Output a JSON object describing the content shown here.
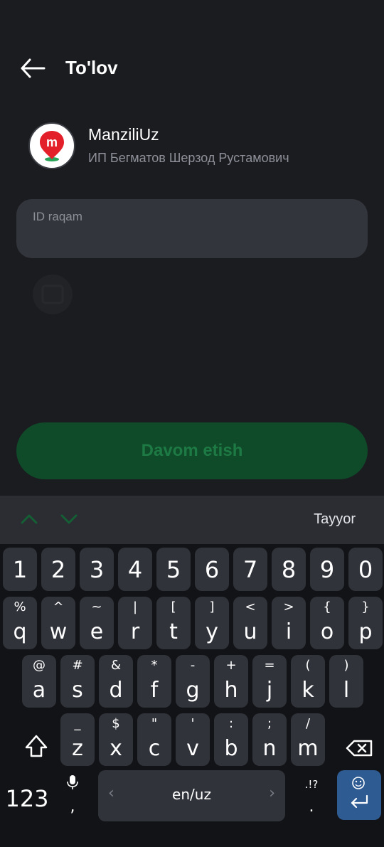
{
  "header": {
    "title": "To'lov"
  },
  "merchant": {
    "name": "ManziliUz",
    "owner": "ИП Бегматов Шерзод Рустамович",
    "logo_letter": "m"
  },
  "form": {
    "id_placeholder": "ID raqam",
    "id_value": ""
  },
  "continue_label": "Davom etish",
  "toolbar": {
    "done_label": "Tayyor"
  },
  "keyboard": {
    "number_row": [
      "1",
      "2",
      "3",
      "4",
      "5",
      "6",
      "7",
      "8",
      "9",
      "0"
    ],
    "row1": [
      {
        "main": "q",
        "sub": "%"
      },
      {
        "main": "w",
        "sub": "^"
      },
      {
        "main": "e",
        "sub": "~"
      },
      {
        "main": "r",
        "sub": "|"
      },
      {
        "main": "t",
        "sub": "["
      },
      {
        "main": "y",
        "sub": "]"
      },
      {
        "main": "u",
        "sub": "<"
      },
      {
        "main": "i",
        "sub": ">"
      },
      {
        "main": "o",
        "sub": "{"
      },
      {
        "main": "p",
        "sub": "}"
      }
    ],
    "row2": [
      {
        "main": "a",
        "sub": "@"
      },
      {
        "main": "s",
        "sub": "#"
      },
      {
        "main": "d",
        "sub": "&"
      },
      {
        "main": "f",
        "sub": "*"
      },
      {
        "main": "g",
        "sub": "-"
      },
      {
        "main": "h",
        "sub": "+"
      },
      {
        "main": "j",
        "sub": "="
      },
      {
        "main": "k",
        "sub": "("
      },
      {
        "main": "l",
        "sub": ")"
      }
    ],
    "row3": [
      {
        "main": "z",
        "sub": "_"
      },
      {
        "main": "x",
        "sub": "$"
      },
      {
        "main": "c",
        "sub": "\""
      },
      {
        "main": "v",
        "sub": "'"
      },
      {
        "main": "b",
        "sub": ":"
      },
      {
        "main": "n",
        "sub": ";"
      },
      {
        "main": "m",
        "sub": "/"
      }
    ],
    "symbols_label": "123",
    "comma_main": ",",
    "period_main": ".",
    "period_sub": ".!?",
    "language_label": "en/uz",
    "left_arrow": "‹",
    "right_arrow": "›"
  }
}
